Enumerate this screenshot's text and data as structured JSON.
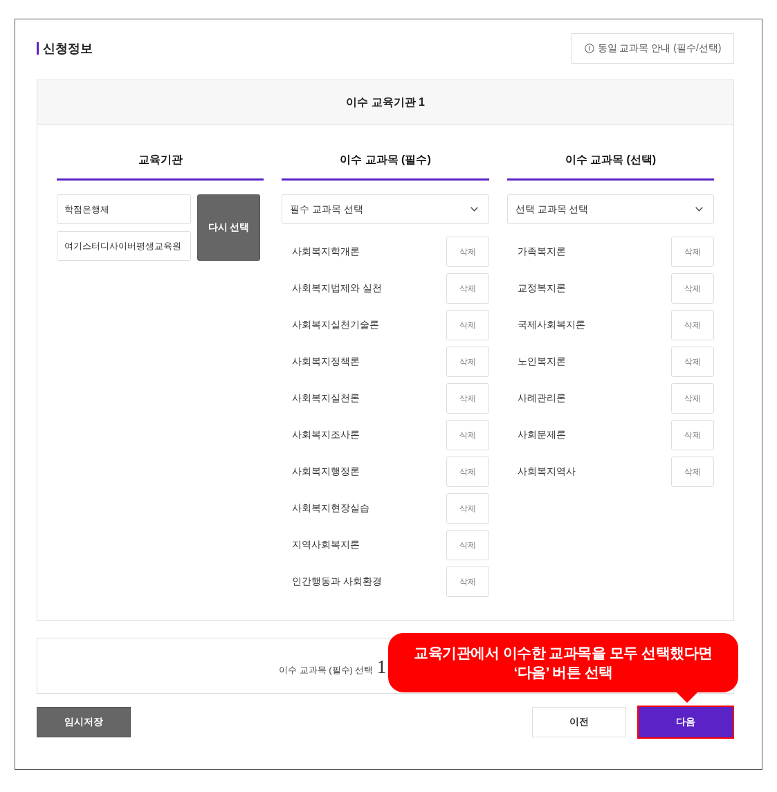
{
  "section_title": "신청정보",
  "guide_button": {
    "label": "동일 교과목 안내 (필수/선택)"
  },
  "panel": {
    "title": "이수 교육기관 1",
    "institution": {
      "heading": "교육기관",
      "fields": [
        {
          "value": "학점은행제"
        },
        {
          "value": "여기스터디사이버평생교육원"
        }
      ],
      "reselect_button": "다시 선택"
    },
    "course_columns": [
      {
        "heading": "이수 교과목 (필수)",
        "select": "필수 교과목 선택",
        "courses": [
          {
            "name": "사회복지학개론",
            "delete_button": "삭제"
          },
          {
            "name": "사회복지법제와 실천",
            "delete_button": "삭제"
          },
          {
            "name": "사회복지실천기술론",
            "delete_button": "삭제"
          },
          {
            "name": "사회복지정책론",
            "delete_button": "삭제"
          },
          {
            "name": "사회복지실천론",
            "delete_button": "삭제"
          },
          {
            "name": "사회복지조사론",
            "delete_button": "삭제"
          },
          {
            "name": "사회복지행정론",
            "delete_button": "삭제"
          },
          {
            "name": "사회복지현장실습",
            "delete_button": "삭제"
          },
          {
            "name": "지역사회복지론",
            "delete_button": "삭제"
          },
          {
            "name": "인간행동과 사회환경",
            "delete_button": "삭제"
          }
        ]
      },
      {
        "heading": "이수 교과목 (선택)",
        "select": "선택 교과목 선택",
        "courses": [
          {
            "name": "가족복지론",
            "delete_button": "삭제"
          },
          {
            "name": "교정복지론",
            "delete_button": "삭제"
          },
          {
            "name": "국제사회복지론",
            "delete_button": "삭제"
          },
          {
            "name": "노인복지론",
            "delete_button": "삭제"
          },
          {
            "name": "사례관리론",
            "delete_button": "삭제"
          },
          {
            "name": "사회문제론",
            "delete_button": "삭제"
          },
          {
            "name": "사회복지역사",
            "delete_button": "삭제"
          }
        ]
      }
    ]
  },
  "summary": {
    "label": "이수 교과목 (필수) 선택",
    "count": "1"
  },
  "buttons": [
    {
      "label": "임시저장",
      "kind": "dark",
      "highlighted": false
    },
    {
      "label": "이전",
      "kind": "outline",
      "highlighted": false
    },
    {
      "label": "다음",
      "kind": "primary",
      "highlighted": true
    }
  ],
  "callout": {
    "text": "교육기관에서 이수한 교과목을 모두 선택했다면\n‘다음’ 버튼 선택"
  }
}
